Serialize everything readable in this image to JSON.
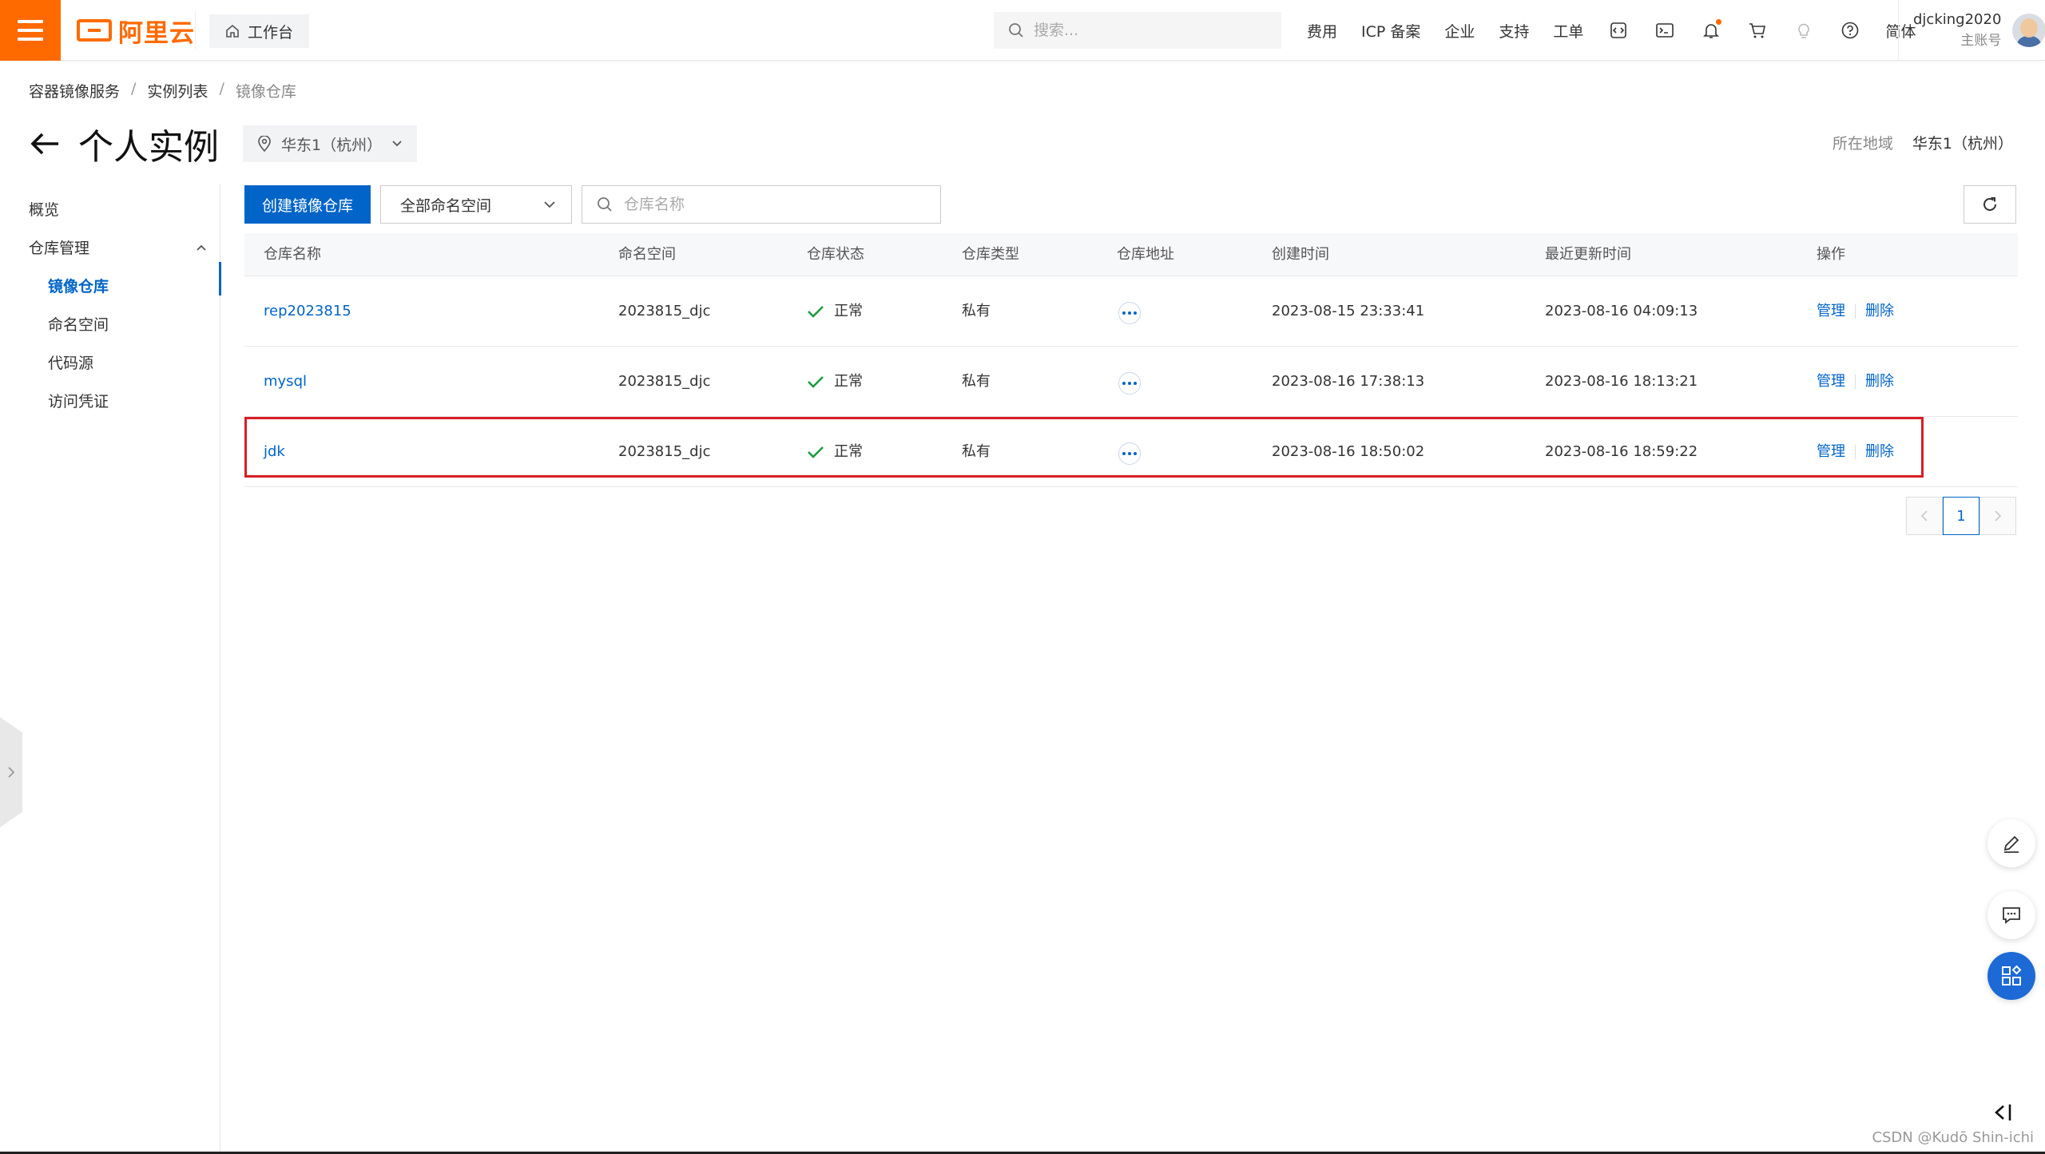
{
  "topbar": {
    "logo_text": "阿里云",
    "workbench_label": "工作台",
    "search_placeholder": "搜索...",
    "links": [
      "费用",
      "ICP 备案",
      "企业",
      "支持",
      "工单"
    ],
    "lang": "简体",
    "icons": [
      "code-icon",
      "terminal-icon",
      "bell-icon",
      "cart-icon",
      "bulb-icon",
      "help-icon"
    ],
    "username": "djcking2020",
    "account_type": "主账号"
  },
  "breadcrumb": [
    "容器镜像服务",
    "实例列表",
    "镜像仓库"
  ],
  "header": {
    "title": "个人实例",
    "region_selector": "华东1（杭州）",
    "region_label": "所在地域",
    "region_value": "华东1（杭州）"
  },
  "sidebar": {
    "overview": "概览",
    "group": "仓库管理",
    "items": [
      "镜像仓库",
      "命名空间",
      "代码源",
      "访问凭证"
    ],
    "active": "镜像仓库"
  },
  "toolbar": {
    "create_button": "创建镜像仓库",
    "namespace_select": "全部命名空间",
    "search_placeholder": "仓库名称"
  },
  "table": {
    "columns": [
      "仓库名称",
      "命名空间",
      "仓库状态",
      "仓库类型",
      "仓库地址",
      "创建时间",
      "最近更新时间",
      "操作"
    ],
    "rows": [
      {
        "name": "rep2023815",
        "namespace": "2023815_djc",
        "status": "正常",
        "type": "私有",
        "created": "2023-08-15 23:33:41",
        "updated": "2023-08-16 04:09:13",
        "op_manage": "管理",
        "op_delete": "删除"
      },
      {
        "name": "mysql",
        "namespace": "2023815_djc",
        "status": "正常",
        "type": "私有",
        "created": "2023-08-16 17:38:13",
        "updated": "2023-08-16 18:13:21",
        "op_manage": "管理",
        "op_delete": "删除"
      },
      {
        "name": "jdk",
        "namespace": "2023815_djc",
        "status": "正常",
        "type": "私有",
        "created": "2023-08-16 18:50:02",
        "updated": "2023-08-16 18:59:22",
        "op_manage": "管理",
        "op_delete": "删除"
      }
    ],
    "highlighted_row": "jdk"
  },
  "pagination": {
    "current": "1"
  },
  "watermark": "CSDN @Kudō Shin-ichi",
  "colors": {
    "brand": "#ff6a00",
    "primary": "#0064c8",
    "success": "#1e9e3e",
    "highlight": "#d81e25"
  }
}
